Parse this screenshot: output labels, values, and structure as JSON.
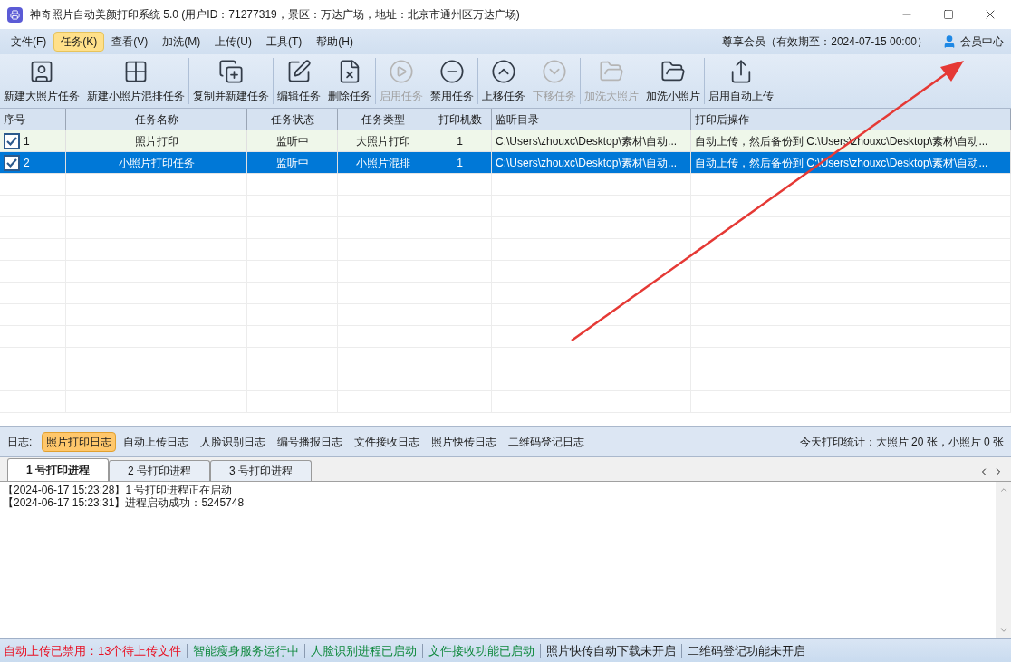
{
  "window": {
    "title": "神奇照片自动美颜打印系统 5.0 (用户ID：71277319，景区：万达广场，地址：北京市通州区万达广场)"
  },
  "menu": [
    {
      "label": "文件(F)",
      "selected": false
    },
    {
      "label": "任务(K)",
      "selected": true
    },
    {
      "label": "查看(V)",
      "selected": false
    },
    {
      "label": "加洗(M)",
      "selected": false
    },
    {
      "label": "上传(U)",
      "selected": false
    },
    {
      "label": "工具(T)",
      "selected": false
    },
    {
      "label": "帮助(H)",
      "selected": false
    }
  ],
  "membership": "尊享会员（有效期至：2024-07-15 00:00）",
  "member_center": "会员中心",
  "toolbar": [
    {
      "kind": "portrait",
      "label": "新建大照片任务",
      "disabled": false,
      "group_start": false
    },
    {
      "kind": "grid",
      "label": "新建小照片混排任务",
      "disabled": false,
      "group_start": false
    },
    {
      "kind": "copy",
      "label": "复制并新建任务",
      "disabled": false,
      "group_start": true
    },
    {
      "kind": "edit",
      "label": "编辑任务",
      "disabled": false,
      "group_start": true
    },
    {
      "kind": "delete",
      "label": "删除任务",
      "disabled": false,
      "group_start": false
    },
    {
      "kind": "play",
      "label": "启用任务",
      "disabled": true,
      "group_start": true
    },
    {
      "kind": "minus",
      "label": "禁用任务",
      "disabled": false,
      "group_start": false
    },
    {
      "kind": "up",
      "label": "上移任务",
      "disabled": false,
      "group_start": true
    },
    {
      "kind": "down",
      "label": "下移任务",
      "disabled": true,
      "group_start": false
    },
    {
      "kind": "folder",
      "label": "加洗大照片",
      "disabled": true,
      "group_start": true
    },
    {
      "kind": "folder",
      "label": "加洗小照片",
      "disabled": false,
      "group_start": false
    },
    {
      "kind": "share",
      "label": "启用自动上传",
      "disabled": false,
      "group_start": true
    }
  ],
  "table": {
    "columns": [
      "序号",
      "任务名称",
      "任务状态",
      "任务类型",
      "打印机数",
      "监听目录",
      "打印后操作"
    ],
    "rows": [
      {
        "checked": true,
        "selected": false,
        "cells": [
          "1",
          "照片打印",
          "监听中",
          "大照片打印",
          "1",
          "C:\\Users\\zhouxc\\Desktop\\素材\\自动...",
          "自动上传，然后备份到 C:\\Users\\zhouxc\\Desktop\\素材\\自动..."
        ]
      },
      {
        "checked": true,
        "selected": true,
        "cells": [
          "2",
          "小照片打印任务",
          "监听中",
          "小照片混排",
          "1",
          "C:\\Users\\zhouxc\\Desktop\\素材\\自动...",
          "自动上传，然后备份到 C:\\Users\\zhouxc\\Desktop\\素材\\自动..."
        ]
      }
    ]
  },
  "log_bar": {
    "label": "日志:",
    "tabs": [
      {
        "label": "照片打印日志",
        "selected": true
      },
      {
        "label": "自动上传日志",
        "selected": false
      },
      {
        "label": "人脸识别日志",
        "selected": false
      },
      {
        "label": "编号播报日志",
        "selected": false
      },
      {
        "label": "文件接收日志",
        "selected": false
      },
      {
        "label": "照片快传日志",
        "selected": false
      },
      {
        "label": "二维码登记日志",
        "selected": false
      }
    ],
    "stats": "今天打印统计：大照片 20 张，小照片 0 张"
  },
  "process_tabs": [
    {
      "label": "1 号打印进程",
      "selected": true
    },
    {
      "label": "2 号打印进程",
      "selected": false
    },
    {
      "label": "3 号打印进程",
      "selected": false
    }
  ],
  "log_lines": [
    "【2024-06-17 15:23:28】1 号打印进程正在启动",
    "【2024-06-17 15:23:31】进程启动成功：5245748"
  ],
  "status_bar": [
    {
      "text": "自动上传已禁用：13个待上传文件",
      "color": "#e81123"
    },
    {
      "text": "智能瘦身服务运行中",
      "color": "#10893e"
    },
    {
      "text": "人脸识别进程已启动",
      "color": "#10893e"
    },
    {
      "text": "文件接收功能已启动",
      "color": "#10893e"
    },
    {
      "text": "照片快传自动下载未开启",
      "color": "#1a1a1a"
    },
    {
      "text": "二维码登记功能未开启",
      "color": "#1a1a1a"
    }
  ]
}
